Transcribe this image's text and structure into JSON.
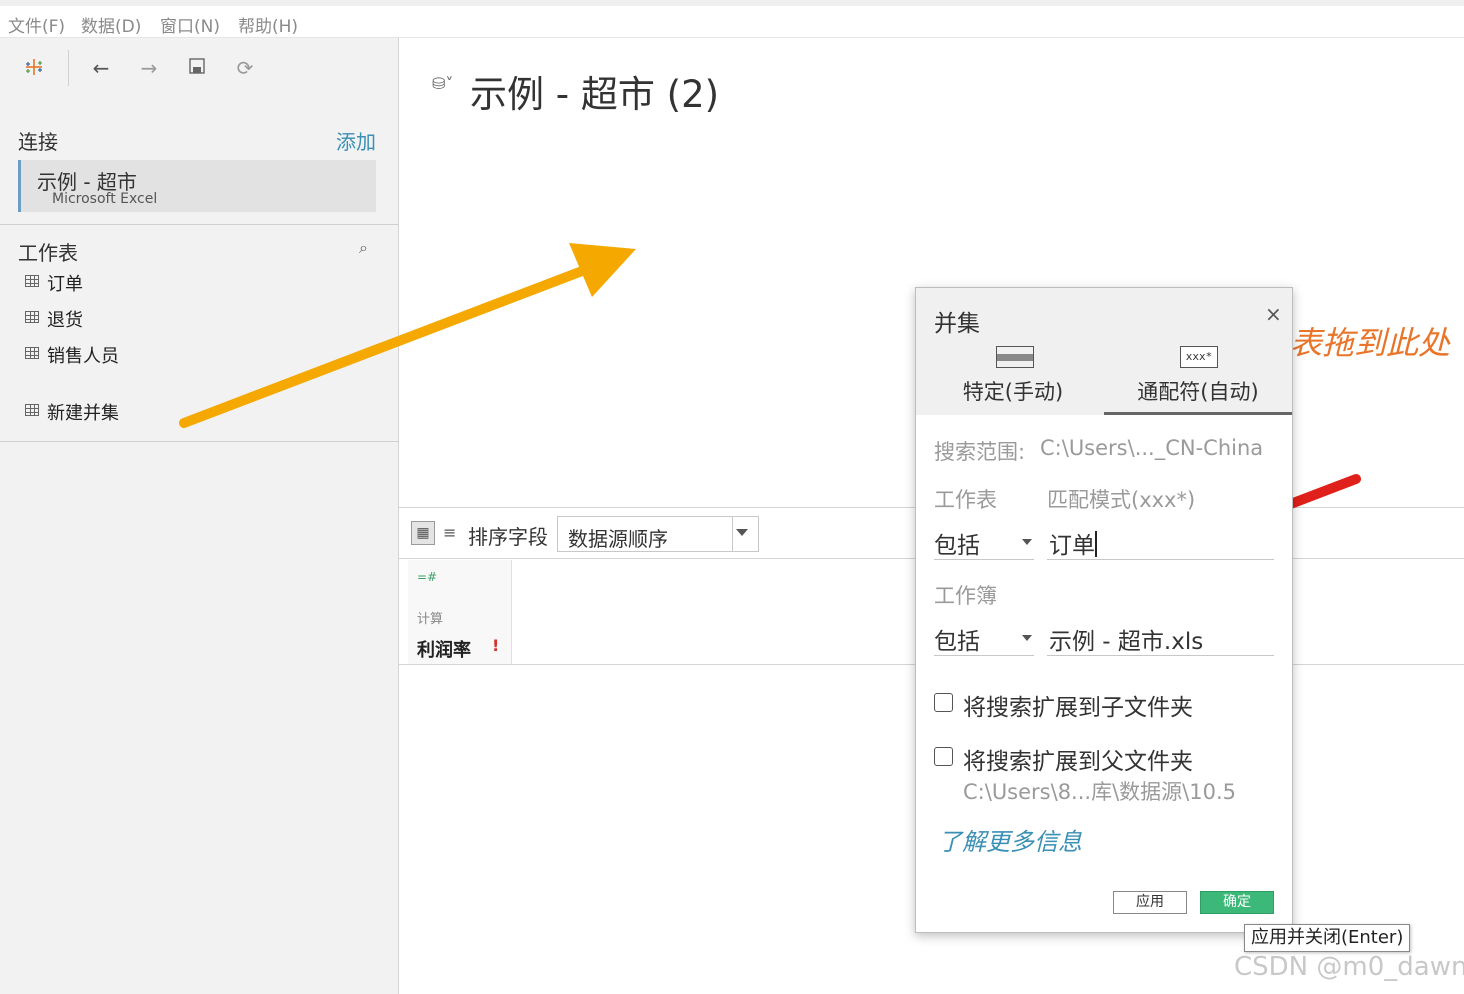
{
  "menu": [
    "文件(F)",
    "数据(D)",
    "窗口(N)",
    "帮助(H)"
  ],
  "toolbar": {
    "logo_icon": "tableau-logo-icon",
    "back_icon": "←",
    "forward_icon": "→",
    "save_icon": "save-icon",
    "refresh_icon": "⟳"
  },
  "sidebar": {
    "connections_title": "连接",
    "add_label": "添加",
    "connection": {
      "name": "示例 - 超市",
      "type": "Microsoft Excel"
    },
    "sheets_title": "工作表",
    "search_icon": "⌕",
    "sheets": [
      "订单",
      "退货",
      "销售人员"
    ],
    "new_union": "新建并集"
  },
  "canvas": {
    "title": "示例 - 超市 (2)",
    "db_icon": "⛁˅",
    "drop_hint": "表拖到此处"
  },
  "grid_toolbar": {
    "sort_label": "排序字段",
    "sort_value": "数据源顺序"
  },
  "grid": {
    "columns": [
      {
        "icon": "=#",
        "type": "计算",
        "name": "利润率",
        "warning": "!"
      }
    ]
  },
  "dialog": {
    "title": "并集",
    "close_icon": "×",
    "tabs": [
      {
        "label": "特定(手动)",
        "icon_text": ""
      },
      {
        "label": "通配符(自动)",
        "icon_text": "xxx*",
        "active": true
      }
    ],
    "search_scope_label": "搜索范围:",
    "search_scope_value": "C:\\Users\\..._CN-China",
    "worksheet_label": "工作表",
    "pattern_label": "匹配模式(xxx*)",
    "worksheet_mode": "包括",
    "worksheet_pattern": "订单",
    "workbook_label": "工作簿",
    "workbook_mode": "包括",
    "workbook_pattern": "示例 - 超市.xls",
    "checkbox_sub": "将搜索扩展到子文件夹",
    "checkbox_parent": "将搜索扩展到父文件夹",
    "parent_path": "C:\\Users\\8...库\\数据源\\10.5",
    "learn_more": "了解更多信息",
    "apply_label": "应用",
    "ok_label": "确定",
    "tooltip": "应用并关闭(Enter)"
  },
  "watermark": "CSDN @m0_dawn",
  "colors": {
    "accent_link": "#3a8fb5",
    "ok_button": "#3cb878",
    "orange_arrow": "#f5a800",
    "red_arrow": "#e0201a",
    "hint": "#e8752a"
  }
}
